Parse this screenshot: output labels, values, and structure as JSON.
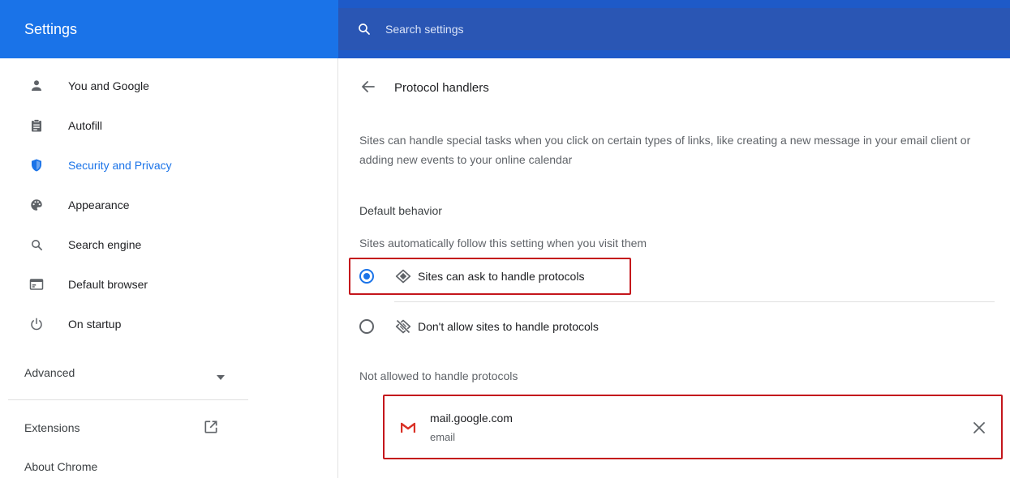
{
  "header": {
    "title": "Settings",
    "search_placeholder": "Search settings"
  },
  "sidebar": {
    "items": [
      {
        "label": "You and Google",
        "icon": "person-icon"
      },
      {
        "label": "Autofill",
        "icon": "clipboard-icon"
      },
      {
        "label": "Security and Privacy",
        "icon": "shield-icon",
        "active": true
      },
      {
        "label": "Appearance",
        "icon": "palette-icon"
      },
      {
        "label": "Search engine",
        "icon": "search-icon"
      },
      {
        "label": "Default browser",
        "icon": "browser-icon"
      },
      {
        "label": "On startup",
        "icon": "power-icon"
      }
    ],
    "advanced_label": "Advanced",
    "extensions_label": "Extensions",
    "about_label": "About Chrome"
  },
  "main": {
    "title": "Protocol handlers",
    "description": "Sites can handle special tasks when you click on certain types of links, like creating a new message in your email client or adding new events to your online calendar",
    "default_behavior_title": "Default behavior",
    "default_behavior_sub": "Sites automatically follow this setting when you visit them",
    "options": [
      {
        "label": "Sites can ask to handle protocols",
        "selected": true
      },
      {
        "label": "Don't allow sites to handle protocols",
        "selected": false
      }
    ],
    "not_allowed_title": "Not allowed to handle protocols",
    "not_allowed_sites": [
      {
        "site": "mail.google.com",
        "protocol": "email"
      }
    ]
  },
  "colors": {
    "accent": "#1a73e8",
    "header_bg": "#1a73e8",
    "search_bg": "#2a56b4",
    "highlight": "#c4161c"
  }
}
